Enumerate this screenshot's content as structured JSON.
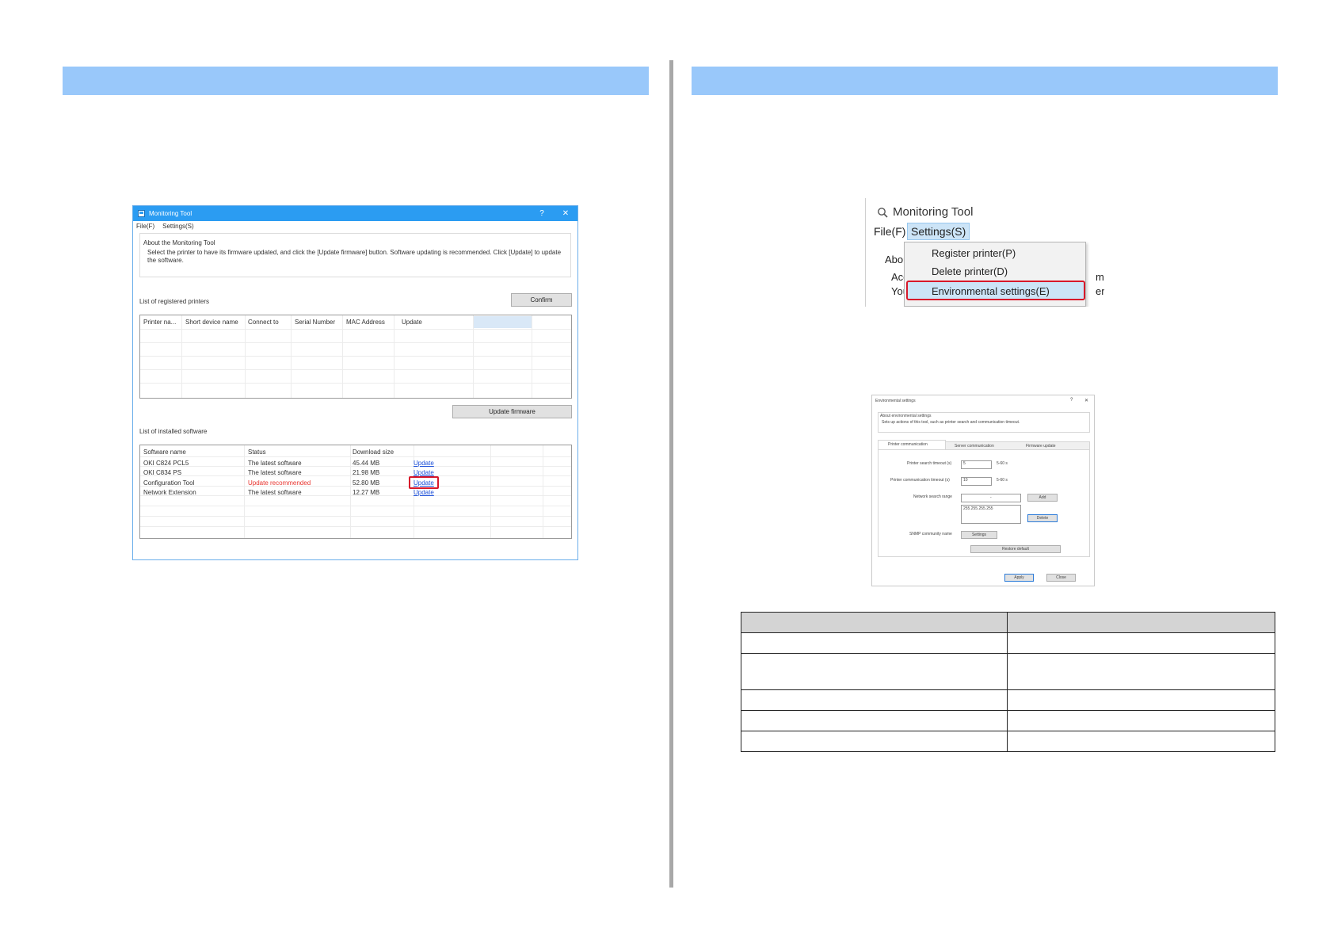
{
  "colors": {
    "section_bar": "#99c8fa",
    "title_bar": "#2b9cf2",
    "highlight": "#d8182a",
    "link": "#1c4fd8",
    "warning": "#e8322d"
  },
  "monitoring_window": {
    "title": "Monitoring Tool",
    "title_icon": "app-icon",
    "help": "?",
    "close": "✕",
    "menu": [
      "File(F)",
      "Settings(S)"
    ],
    "about_heading": "About the Monitoring Tool",
    "about_text_1": "Select the printer to have its firmware updated, and click the [Update firmware] button. Software updating is recommended. Click [Update] to update",
    "about_text_2": "the software.",
    "registered_label": "List of registered printers",
    "confirm_button": "Confirm",
    "printer_columns": [
      "Printer na...",
      "Short device name",
      "Connect to",
      "Serial Number",
      "MAC Address",
      "Update"
    ],
    "update_firmware_button": "Update firmware",
    "installed_label": "List of installed software",
    "software_columns": [
      "Software name",
      "Status",
      "Download size"
    ],
    "software_rows": [
      {
        "name": "OKI C824 PCL5",
        "status": "The latest software",
        "size": "45.44 MB",
        "action": "Update"
      },
      {
        "name": "OKI C834 PS",
        "status": "The latest software",
        "size": "21.98 MB",
        "action": "Update"
      },
      {
        "name": "Configuration Tool",
        "status": "Update recommended",
        "size": "52.80 MB",
        "action": "Update"
      },
      {
        "name": "Network Extension",
        "status": "The latest software",
        "size": "12.27 MB",
        "action": "Update"
      }
    ]
  },
  "menu_crop": {
    "title": "Monitoring Tool",
    "title_icon": "search-icon",
    "file_menu": "File(F)",
    "settings_menu": "Settings(S)",
    "items": [
      "Register printer(P)",
      "Delete printer(D)",
      "Environmental settings(E)"
    ],
    "behind_1": "Abou",
    "behind_2": "Acc",
    "behind_3": "You",
    "behind_right_1": "m",
    "behind_right_2": "er"
  },
  "env_dialog": {
    "title": "Environmental settings",
    "help": "?",
    "close": "✕",
    "about_heading": "About environmental settings",
    "about_text": "Sets up actions of this tool, such as printer search and communication timeout.",
    "tabs": [
      "Printer communication",
      "Server communication",
      "Firmware update"
    ],
    "search_timeout_label": "Printer search timeout (s)",
    "search_timeout_value": "5",
    "search_timeout_range": "5-60 s",
    "comm_timeout_label": "Printer communication timeout (s)",
    "comm_timeout_value": "10",
    "comm_timeout_range": "5-60 s",
    "network_range_label": "Network search range",
    "network_range_sep": "-",
    "add_button": "Add",
    "range_item": "255.255.255.255",
    "delete_button": "Delete",
    "snmp_label": "SNMP community name",
    "settings_button": "Settings",
    "restore_button": "Restore default",
    "apply_button": "Apply",
    "close_button": "Close"
  }
}
